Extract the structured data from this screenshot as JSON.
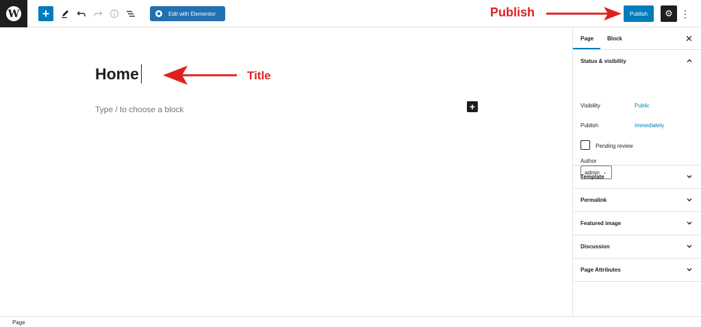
{
  "toolbar": {
    "logo_letter": "W",
    "add_symbol": "+",
    "elementor_label": "Edit with Elementor",
    "publish_label": "Publish"
  },
  "annotations": {
    "publish": "Publish",
    "title": "Title",
    "color": "#e02020"
  },
  "editor": {
    "title": "Home",
    "placeholder": "Type / to choose a block",
    "inserter_symbol": "+"
  },
  "sidebar": {
    "tabs": [
      {
        "label": "Page",
        "active": true
      },
      {
        "label": "Block",
        "active": false
      }
    ],
    "status_visibility": {
      "title": "Status & visibility",
      "visibility_label": "Visibility",
      "visibility_value": "Public",
      "publish_label": "Publish",
      "publish_value": "Immediately",
      "pending_label": "Pending review",
      "author_label": "Author",
      "author_value": "admin"
    },
    "panels": [
      {
        "title": "Template"
      },
      {
        "title": "Permalink"
      },
      {
        "title": "Featured image"
      },
      {
        "title": "Discussion"
      },
      {
        "title": "Page Attributes"
      }
    ]
  },
  "footer": {
    "breadcrumb": "Page"
  },
  "colors": {
    "accent": "#007cba",
    "dark": "#1e1e1e",
    "annotation": "#e02020"
  }
}
